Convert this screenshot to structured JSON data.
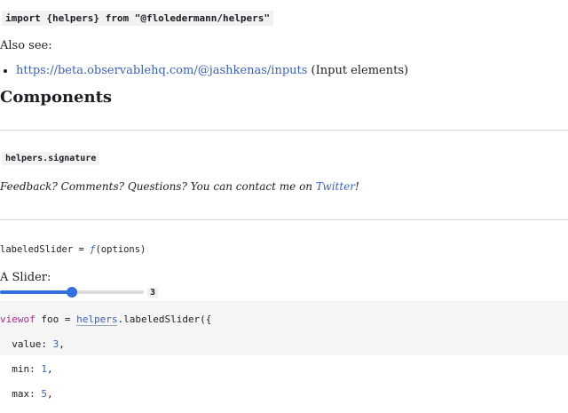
{
  "cells": {
    "import_code": "import {helpers} from \"@floledermann/helpers\"",
    "also_see_label": "Also see:",
    "link_inputs_url": "https://beta.observablehq.com/@jashkenas/inputs",
    "link_inputs_suffix": " (Input elements)",
    "components_heading": "Components",
    "signature_code": "helpers.signature",
    "feedback_prefix": "Feedback? Comments? Questions? You can contact me on ",
    "feedback_link": "Twitter",
    "feedback_suffix": "!",
    "labeled_slider_name": "labeledSlider = ",
    "labeled_slider_f": "ƒ",
    "labeled_slider_args": "(options)",
    "slider_label": "A Slider:",
    "slider_min": 1,
    "slider_max": 5,
    "slider_value": 3,
    "slider_value_text": "3"
  },
  "code_block": {
    "line1_kw": "viewof",
    "line1_mid": " foo = ",
    "line1_ref": "helpers",
    "line1_end": ".labeledSlider({",
    "line2_key": "  value: ",
    "line2_val": "3",
    "line2_end": ",",
    "line3_key": "  min: ",
    "line3_val": "1",
    "line3_end": ",",
    "line4_key": "  max: ",
    "line4_val": "5",
    "line4_end": ","
  },
  "colors": {
    "link": "#3b5fc0",
    "slider_accent": "#2f6fe0",
    "keyword": "#a0318c"
  }
}
